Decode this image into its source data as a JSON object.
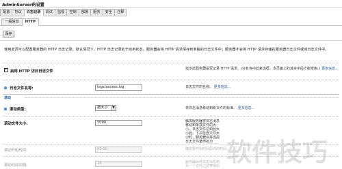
{
  "window": {
    "title": "AdminServer的设置"
  },
  "tabs_primary": [
    {
      "label": "配置",
      "active": false
    },
    {
      "label": "协议",
      "active": false
    },
    {
      "label": "日志记录",
      "active": true
    },
    {
      "label": "调试",
      "active": false
    },
    {
      "label": "监视",
      "active": false
    },
    {
      "label": "控制",
      "active": false
    },
    {
      "label": "部署",
      "active": false
    },
    {
      "label": "服务",
      "active": false
    },
    {
      "label": "安全",
      "active": false
    },
    {
      "label": "注释",
      "active": false
    }
  ],
  "tabs_secondary": [
    {
      "label": "一般信息",
      "active": false
    },
    {
      "label": "HTTP",
      "active": true
    }
  ],
  "toolbar": {
    "save_label": "保存"
  },
  "description": "使用此页可以配置服务器的 HTTP 日志记录。默认情况下，HTTP 日志记录处于启用状态，服务器会将 HTTP 请求保存到单独的日志文件中；服务器不会将 HTTP 请求存储在服务器日志文件或域日志文件中。",
  "fields": {
    "enable_http_log": {
      "label": "启用 HTTP 访问日志文件",
      "checked": true,
      "help": "指示此服务器是否记录 HTTP 请求。(只有当中此复选框，本页面上的其余字段才能使用。)",
      "more": "更多信息..."
    },
    "log_file_name": {
      "label": "日志文件名称:",
      "value": "logs/access.log",
      "help": "日志文件的名称。",
      "more": "更多信息..."
    },
    "section_rotation": {
      "title": "滚动"
    },
    "rotation_type": {
      "label": "滚动类型:",
      "value": "按大小",
      "help": "将日志消息移动到新文件的标准。",
      "more": "更多信息..."
    },
    "rotation_file_size": {
      "label": "滚动文件大小:",
      "value": "5000",
      "help": "触发服务器将日志消息移动到单独文件的大小。日志文件达到此大小后，下次检查文件大小时，服务器会将当前日志文件重命名为 FileName.n，并创建一个新的日志文件来存储后续消息。(需要将滚动类型设置为 SIZE)"
    },
    "rotation_start_time": {
      "label": "滚动开始时间:",
      "value": "00:00",
      "help": "确定要开始时间段内的时间。"
    },
    "rotation_interval": {
      "label": "滚动时间间隔:",
      "value": "24",
      "help": "服务器保存日志消息到另一个文件之前等待的小时数。(如果 Time 类型的滚动要求)"
    }
  },
  "watermark": {
    "text": "软件技巧"
  }
}
